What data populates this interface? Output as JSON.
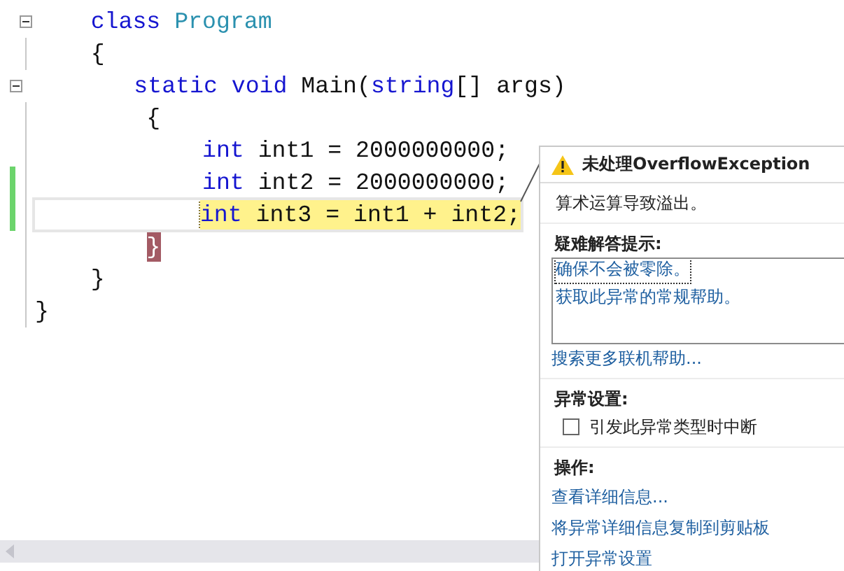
{
  "code_lines": [
    {
      "changed": false,
      "foldable": true,
      "current": false,
      "marked": false,
      "tokens": [
        {
          "kind": "keyword",
          "text": "    class"
        },
        {
          "kind": "type",
          "text": " Program"
        }
      ]
    },
    {
      "changed": false,
      "foldable": false,
      "current": false,
      "marked": false,
      "tokens": [
        {
          "kind": "plain",
          "text": "    {"
        }
      ]
    },
    {
      "changed": false,
      "foldable": true,
      "current": false,
      "marked": false,
      "tokens": [
        {
          "kind": "keyword",
          "text": "        static"
        },
        {
          "kind": "keyword",
          "text": " void"
        },
        {
          "kind": "plain",
          "text": " Main("
        },
        {
          "kind": "keyword",
          "text": "string"
        },
        {
          "kind": "plain",
          "text": "[] args)"
        }
      ]
    },
    {
      "changed": false,
      "foldable": false,
      "current": false,
      "marked": false,
      "tokens": [
        {
          "kind": "plain",
          "text": "        {"
        }
      ]
    },
    {
      "changed": false,
      "foldable": false,
      "current": false,
      "marked": false,
      "tokens": [
        {
          "kind": "keyword",
          "text": "            int"
        },
        {
          "kind": "plain",
          "text": " int1 = 2000000000;"
        }
      ]
    },
    {
      "changed": true,
      "foldable": false,
      "current": false,
      "marked": false,
      "tokens": [
        {
          "kind": "keyword",
          "text": "            int"
        },
        {
          "kind": "plain",
          "text": " int2 = 2000000000;"
        }
      ]
    },
    {
      "changed": true,
      "foldable": false,
      "current": true,
      "marked": false,
      "tokens": [
        {
          "kind": "keyword",
          "text": "            int"
        },
        {
          "kind": "plain",
          "text": " int3 = int1 + int2;"
        }
      ]
    },
    {
      "changed": false,
      "foldable": false,
      "current": false,
      "marked": true,
      "tokens": [
        {
          "kind": "plain",
          "text": "        }"
        }
      ]
    },
    {
      "changed": false,
      "foldable": false,
      "current": false,
      "marked": false,
      "tokens": [
        {
          "kind": "plain",
          "text": "    }"
        }
      ]
    },
    {
      "changed": false,
      "foldable": false,
      "current": false,
      "marked": false,
      "tokens": [
        {
          "kind": "plain",
          "text": "}"
        }
      ]
    }
  ],
  "exception_popup": {
    "title": "未处理OverflowException",
    "message": "算术运算导致溢出。",
    "tips_heading": "疑难解答提示:",
    "tips": [
      "确保不会被零除。",
      "获取此异常的常规帮助。"
    ],
    "search_link": "搜索更多联机帮助...",
    "settings_heading": "异常设置:",
    "settings": [
      {
        "label": "引发此异常类型时中断",
        "checked": false
      }
    ],
    "actions_heading": "操作:",
    "actions": [
      "查看详细信息...",
      "将异常详细信息复制到剪贴板",
      "打开异常设置"
    ]
  }
}
